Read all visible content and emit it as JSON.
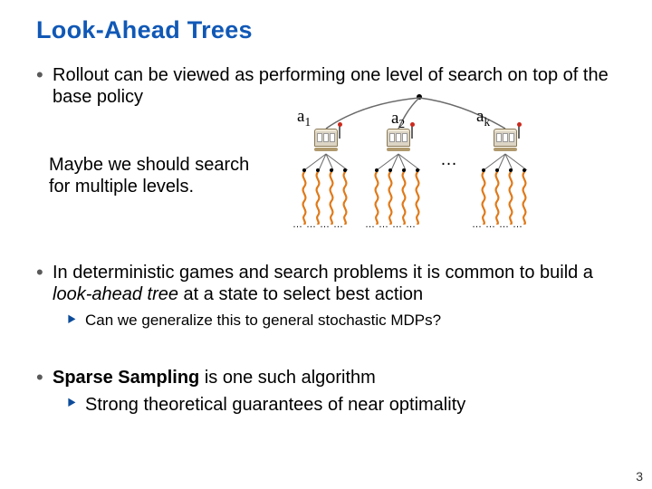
{
  "title": "Look-Ahead Trees",
  "bullet1": "Rollout can be viewed as performing one level of search on top of the base policy",
  "side_note": "Maybe we should search for multiple levels.",
  "action_labels": {
    "a1": "a",
    "a1_sub": "1",
    "a2": "a",
    "a2_sub": "2",
    "ak": "a",
    "ak_sub": "k"
  },
  "tree_ellipsis": "…",
  "bullet2_pre": "In deterministic games and search problems it is common to build a ",
  "bullet2_em": "look-ahead tree",
  "bullet2_post": " at a state to select best action",
  "sub2": "Can we generalize this to general stochastic MDPs?",
  "bullet3_pre": "",
  "bullet3_strong": "Sparse Sampling",
  "bullet3_post": " is one such algorithm",
  "sub3": "Strong theoretical guarantees of near optimality",
  "page_number": "3"
}
